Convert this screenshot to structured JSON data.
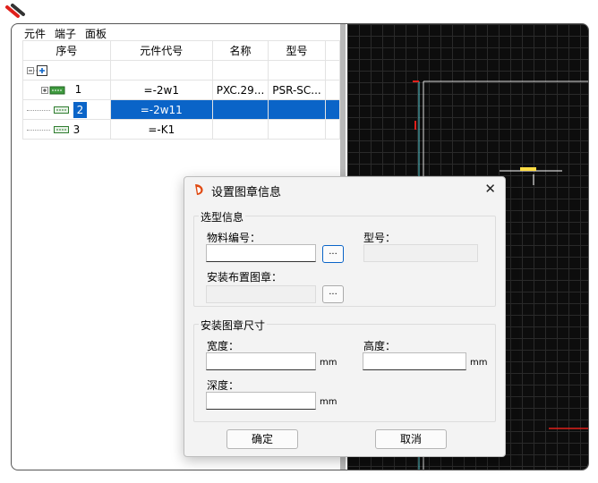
{
  "tabs": [
    "元件",
    "端子",
    "面板"
  ],
  "columns": [
    "序号",
    "元件代号",
    "名称",
    "型号"
  ],
  "rows": [
    {
      "index": "1",
      "code": "=-2w1",
      "name": "PXC.29...",
      "model": "PSR-SC..."
    },
    {
      "index": "2",
      "code": "=-2w11",
      "name": "",
      "model": ""
    },
    {
      "index": "3",
      "code": "=-K1",
      "name": "",
      "model": ""
    }
  ],
  "dialog": {
    "title": "设置图章信息",
    "close": "✕",
    "group_selection": "选型信息",
    "material_code_label": "物料编号：",
    "model_label": "型号：",
    "install_stamp_label": "安装布置图章：",
    "browse_label": "...",
    "group_size": "安装图章尺寸",
    "width_label": "宽度：",
    "height_label": "高度：",
    "depth_label": "深度：",
    "unit": "mm",
    "ok": "确定",
    "cancel": "取消"
  },
  "colors": {
    "selection": "#0a64c8",
    "cad_bg": "#0d0d0d",
    "cad_line": "#5ad0d6",
    "accent_red": "#e0201b"
  }
}
